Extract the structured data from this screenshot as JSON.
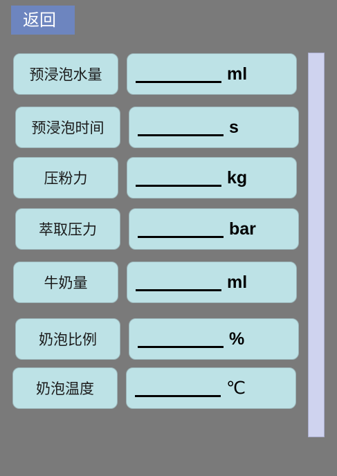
{
  "header": {
    "back_label": "返回"
  },
  "rows": [
    {
      "label": "预浸泡水量",
      "unit": "ml"
    },
    {
      "label": "预浸泡时间",
      "unit": "s"
    },
    {
      "label": "压粉力",
      "unit": "kg"
    },
    {
      "label": "萃取压力",
      "unit": "bar"
    },
    {
      "label": "牛奶量",
      "unit": "ml"
    },
    {
      "label": "奶泡比例",
      "unit": "%"
    },
    {
      "label": "奶泡温度",
      "unit": "℃"
    }
  ],
  "colors": {
    "background": "#7a7a7a",
    "back_button": "#6d85bf",
    "field": "#bde2e6",
    "scrollbar": "#cfd3ef"
  }
}
